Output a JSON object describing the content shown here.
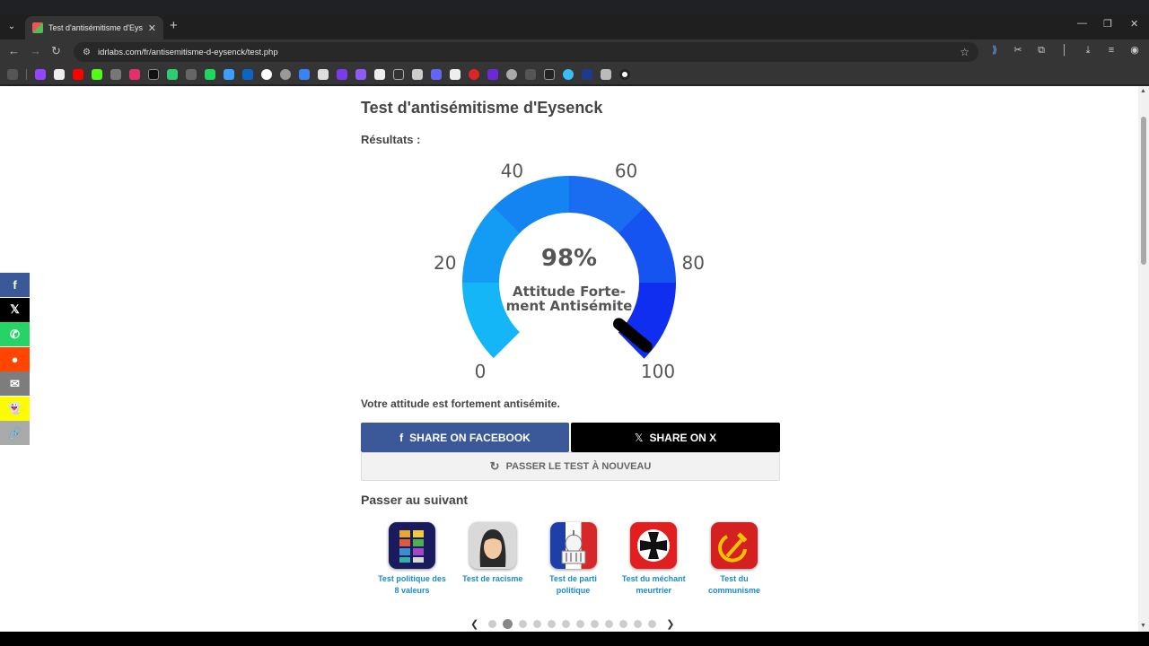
{
  "browser": {
    "tab_title": "Test d'antisémitisme d'Eysenck",
    "tab_close": "✕",
    "new_tab": "+",
    "url": "idrlabs.com/fr/antisemitisme-d-eysenck/test.php",
    "win_min": "—",
    "win_restore": "❐",
    "win_close": "✕"
  },
  "page": {
    "title": "Test d'antisémitisme d'Eysenck",
    "results_label": "Résultats :",
    "verdict": "Votre attitude est fortement antisémite.",
    "share_facebook": "SHARE ON FACEBOOK",
    "share_x": "SHARE ON X",
    "retake": "PASSER LE TEST À NOUVEAU",
    "next_title": "Passer au suivant"
  },
  "gauge": {
    "value_percent": 98,
    "value_label": "98%",
    "caption_line1": "Attitude Forte-",
    "caption_line2": "ment Antisémite",
    "tick_labels": [
      "0",
      "20",
      "40",
      "60",
      "80",
      "100"
    ],
    "colors": [
      "#14b6f7",
      "#149cf5",
      "#1584f3",
      "#1a6cf1",
      "#1554f0",
      "#0f2ef0"
    ],
    "needle_color": "#000000"
  },
  "related_tests": [
    {
      "label_line1": "Test politique des",
      "label_line2": "8 valeurs",
      "icon": "8values-grid-icon"
    },
    {
      "label_line1": "Test de racisme",
      "label_line2": "",
      "icon": "woman-face-icon"
    },
    {
      "label_line1": "Test de parti",
      "label_line2": "politique",
      "icon": "capitol-flag-icon"
    },
    {
      "label_line1": "Test du méchant",
      "label_line2": "meurtrier",
      "icon": "iron-cross-icon"
    },
    {
      "label_line1": "Test du",
      "label_line2": "communisme",
      "icon": "hammer-sickle-icon"
    }
  ],
  "pager": {
    "current_page": 2,
    "total_pages": 12
  },
  "share_bar": [
    {
      "name": "facebook",
      "glyph": "f",
      "color": "#3b5998"
    },
    {
      "name": "x",
      "glyph": "𝕏",
      "color": "#000000"
    },
    {
      "name": "whatsapp",
      "glyph": "✆",
      "color": "#25d366"
    },
    {
      "name": "reddit",
      "glyph": "●",
      "color": "#ff4500"
    },
    {
      "name": "email",
      "glyph": "✉",
      "color": "#7d7d7d"
    },
    {
      "name": "snapchat",
      "glyph": "👻",
      "color": "#fffc00"
    },
    {
      "name": "copy-link",
      "glyph": "🔗",
      "color": "#aaaaaa"
    }
  ]
}
